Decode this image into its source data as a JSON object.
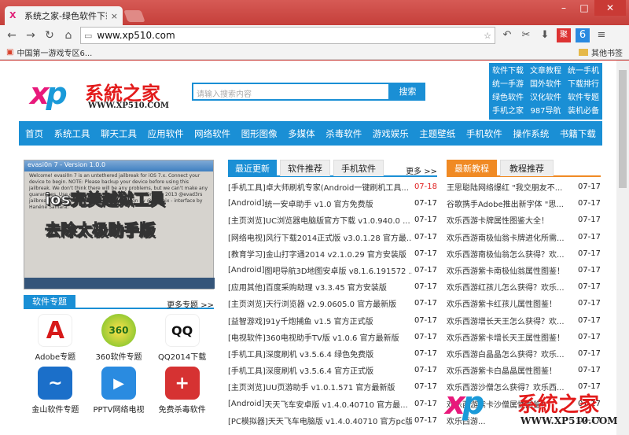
{
  "browser": {
    "tab_title": "系统之家-绿色软件下载,最",
    "tab_close": "×",
    "url": "www.xp510.com",
    "bookmark1": "中国第一游戏专区6...",
    "other_bookmarks": "其他书签",
    "win_min": "–",
    "win_max": "□",
    "win_close": "✕"
  },
  "header": {
    "logo_xp": "x",
    "logo_p": "p",
    "logo_cn": "系統之家",
    "logo_en": "WWW.XP510.COM",
    "search_placeholder": "请输入搜索内容",
    "search_btn": "搜索",
    "quick": [
      "软件下载",
      "文章教程",
      "统一手机",
      "统一手游",
      "国外软件",
      "下载排行",
      "绿色软件",
      "汉化软件",
      "软件专题",
      "手机之家",
      "987导航",
      "装机必备"
    ]
  },
  "nav": [
    "首页",
    "系统工具",
    "聊天工具",
    "应用软件",
    "网络软件",
    "图形图像",
    "多媒体",
    "杀毒软件",
    "游戏娱乐",
    "主题壁纸",
    "手机软件",
    "操作系统",
    "书籍下载"
  ],
  "banner": {
    "wtitle": "evasi0n 7 - Version 1.0.0",
    "big1": "ios完美越狱工具",
    "big2": "去除太极助手版",
    "small": "Welcome! evasi0n 7 is an untethered jailbreak for iOS 7.x. Connect your device to begin. NOTE: Please backup your device before using this jailbreak. We don't think there will be any problems, but we can't make any guarantees. Use evasi0n 7 at your own risk. evasi0n 7 © 2013 @evad3rs jailbreak exploits by @evad3rs graphic design by @Surenix - interface by Hanéne Samara."
  },
  "topics": {
    "label": "软件专题",
    "more": "更多专题 >>",
    "apps": [
      {
        "name": "Adobe专题",
        "icon": "A"
      },
      {
        "name": "360软件专题",
        "icon": "360"
      },
      {
        "name": "QQ2014下载",
        "icon": "QQ"
      },
      {
        "name": "金山软件专题",
        "icon": "~"
      },
      {
        "name": "PPTV网络电视",
        "icon": "▶"
      },
      {
        "name": "免费杀毒软件",
        "icon": "+"
      }
    ]
  },
  "mid": {
    "tab1": "最近更新",
    "tab2": "软件推荐",
    "tab3": "手机软件",
    "more": "更多 >>",
    "rows": [
      {
        "cat": "[手机工具]",
        "title": " 卓大师刷机专家(Android一键刷机工具...",
        "date": "07-18"
      },
      {
        "cat": "[Android]",
        "title": " 统一安卓助手 v1.0 官方免费版",
        "date": "07-17"
      },
      {
        "cat": "[主页浏览]",
        "title": " UC浏览器电脑版官方下载 v1.0.940.0 ...",
        "date": "07-17"
      },
      {
        "cat": "[网络电视]",
        "title": " 风行下载2014正式版 v3.0.1.28 官方最...",
        "date": "07-17"
      },
      {
        "cat": "[教育学习]",
        "title": " 金山打字通2014 v2.1.0.29 官方安装版",
        "date": "07-17"
      },
      {
        "cat": "[Android]",
        "title": " 图吧导航3D地图安卓版 v8.1.6.191572 ...",
        "date": "07-17"
      },
      {
        "cat": "[应用其他]",
        "title": " 百度采购助理 v3.3.45 官方安装版",
        "date": "07-17"
      },
      {
        "cat": "[主页浏览]",
        "title": " 天行浏览器 v2.9.0605.0 官方最新版",
        "date": "07-17"
      },
      {
        "cat": "[益智游戏]",
        "title": " 91y千炮捕鱼 v1.5 官方正式版",
        "date": "07-17"
      },
      {
        "cat": "[电视软件]",
        "title": " 360电视助手TV版 v1.0.6 官方最新版",
        "date": "07-17"
      },
      {
        "cat": "[手机工具]",
        "title": " 深度刷机 v3.5.6.4 绿色免费版",
        "date": "07-17"
      },
      {
        "cat": "[手机工具]",
        "title": " 深度刷机 v3.5.6.4 官方正式版",
        "date": "07-17"
      },
      {
        "cat": "[主页浏览]",
        "title": " UU页游助手 v1.0.1.571 官方最新版",
        "date": "07-17"
      },
      {
        "cat": "[Android]",
        "title": " 天天飞车安卓版 v1.4.0.40710 官方最...",
        "date": "07-17"
      },
      {
        "cat": "[PC模拟器]",
        "title": " 天天飞车电脑版 v1.4.0.40710 官方pc版",
        "date": "07-17"
      }
    ]
  },
  "right": {
    "tab1": "最新教程",
    "tab2": "教程推荐",
    "rows": [
      {
        "title": "王思聪陆网络爆红 \"我交朋友不...",
        "date": "07-17"
      },
      {
        "title": "谷歌携手Adobe推出新字体 \"思...",
        "date": "07-17"
      },
      {
        "title": "欢乐西游卡牌属性图鉴大全！",
        "date": "07-17"
      },
      {
        "title": "欢乐西游南极仙翁卡牌进化所需...",
        "date": "07-17"
      },
      {
        "title": "欢乐西游南极仙翁怎么获得？欢...",
        "date": "07-17"
      },
      {
        "title": "欢乐西游紫卡南极仙翁属性图鉴！",
        "date": "07-17"
      },
      {
        "title": "欢乐西游红孩儿怎么获得？欢乐...",
        "date": "07-17"
      },
      {
        "title": "欢乐西游紫卡红孩儿属性图鉴！",
        "date": "07-17"
      },
      {
        "title": "欢乐西游增长天王怎么获得？欢...",
        "date": "07-17"
      },
      {
        "title": "欢乐西游紫卡增长天王属性图鉴！",
        "date": "07-17"
      },
      {
        "title": "欢乐西游白晶晶怎么获得？欢乐...",
        "date": "07-17"
      },
      {
        "title": "欢乐西游紫卡白晶晶属性图鉴！",
        "date": "07-17"
      },
      {
        "title": "欢乐西游沙僧怎么获得？欢乐西...",
        "date": "07-17"
      },
      {
        "title": "欢乐西游紫卡沙僧属性图鉴！",
        "date": "07-17"
      },
      {
        "title": "欢乐西游...",
        "date": "07-17"
      }
    ]
  },
  "watermark": {
    "xp": "x",
    "p": "p",
    "cn": "系統之家",
    "en": "WWW.XP510.COM"
  }
}
